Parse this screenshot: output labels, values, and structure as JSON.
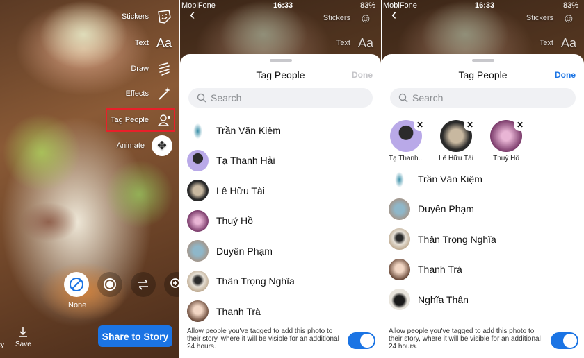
{
  "status_bar": {
    "carrier": "MobiFone",
    "time": "16:33",
    "battery": "83%"
  },
  "editor": {
    "tools": [
      {
        "label": "Stickers",
        "icon": "sticker-icon"
      },
      {
        "label": "Text",
        "icon": "text-icon",
        "glyph": "Aa"
      },
      {
        "label": "Draw",
        "icon": "draw-icon"
      },
      {
        "label": "Effects",
        "icon": "effects-wand-icon"
      },
      {
        "label": "Tag People",
        "icon": "tag-people-icon"
      },
      {
        "label": "Animate",
        "icon": "move-arrows-icon"
      }
    ],
    "filter_label": "None",
    "save_label": "Save",
    "privacy_label": "cy",
    "share_button": "Share to Story",
    "accent": "#1b74e4",
    "highlight": "#e8202a"
  },
  "tag_sheet": {
    "title": "Tag People",
    "done_label": "Done",
    "search_placeholder": "Search",
    "footer_text": "Allow people you've tagged to add this photo to their story, where it will be visible for an additional 24 hours.",
    "toggle_on": true
  },
  "panel2_people": [
    {
      "name": "Trần Văn Kiệm"
    },
    {
      "name": "Tạ Thanh Hải"
    },
    {
      "name": "Lê Hữu Tài"
    },
    {
      "name": "Thuý Hồ"
    },
    {
      "name": "Duyên Phạm"
    },
    {
      "name": "Thân Trọng Nghĩa"
    },
    {
      "name": "Thanh Trà"
    }
  ],
  "panel3_selected": [
    {
      "name": "Tạ Thanh..."
    },
    {
      "name": "Lê Hữu Tài"
    },
    {
      "name": "Thuý Hồ"
    }
  ],
  "panel3_people": [
    {
      "name": "Trần Văn Kiệm"
    },
    {
      "name": "Duyên Phạm"
    },
    {
      "name": "Thân Trọng Nghĩa"
    },
    {
      "name": "Thanh Trà"
    },
    {
      "name": "Nghĩa Thân"
    }
  ]
}
